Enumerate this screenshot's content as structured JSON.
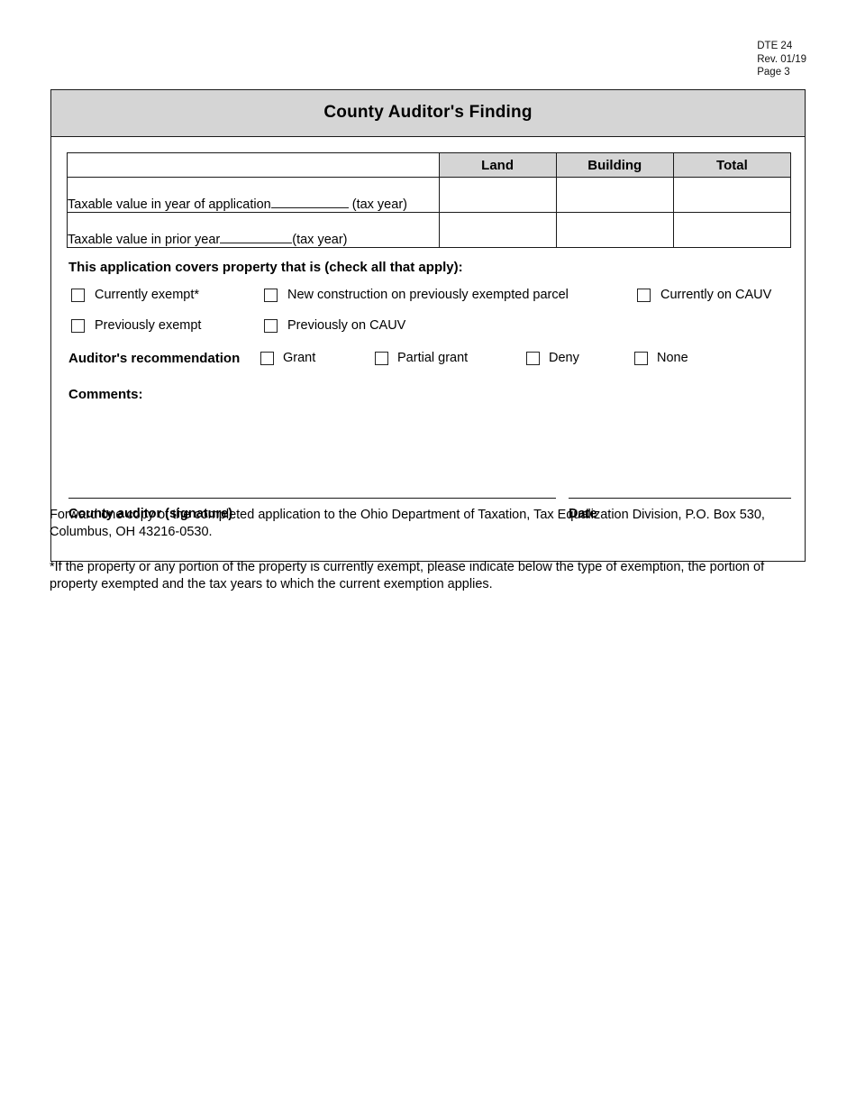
{
  "document_header": {
    "form_number": "DTE 24",
    "revision": "Rev. 01/19",
    "page": "Page 3"
  },
  "panel": {
    "title": "County Auditor's Finding",
    "value_table": {
      "blank_header": "",
      "columns": [
        "Land",
        "Building",
        "Total"
      ],
      "rows": [
        {
          "label_before_blank": "Taxable value in year of application",
          "label_after_blank": "(tax year)",
          "land": "",
          "building": "",
          "total": ""
        },
        {
          "label_before_blank": "Taxable value in prior year",
          "label_after_blank": "(tax year)",
          "land": "",
          "building": "",
          "total": ""
        }
      ]
    },
    "coverage": {
      "heading": "This application covers property that is (check all that apply):",
      "options": [
        "Currently exempt*",
        "New construction on previously exempted parcel",
        "Currently on CAUV",
        "Previously exempt",
        "Previously on CAUV"
      ]
    },
    "recommendation": {
      "label": "Auditor's recommendation",
      "options": [
        "Grant",
        "Partial grant",
        "Deny",
        "None"
      ]
    },
    "comments_label": "Comments:",
    "comments_value": "",
    "signature": {
      "auditor_label": "County auditor (signature)",
      "auditor_value": "",
      "date_label": "Date",
      "date_value": ""
    }
  },
  "footer": {
    "paragraph_1": "Forward one copy of the completed application to the Ohio Department of Taxation, Tax Equalization Division, P.O. Box 530, Columbus, OH  43216-0530.",
    "paragraph_2": "*If the property or any portion of the property is currently exempt, please indicate below the type of exemption, the portion of property exempted and the tax years to which the current exemption applies."
  },
  "colors": {
    "header_gray": "#d5d5d5",
    "border": "#1a1a1a",
    "text": "#000000",
    "page_background": "#ffffff"
  }
}
